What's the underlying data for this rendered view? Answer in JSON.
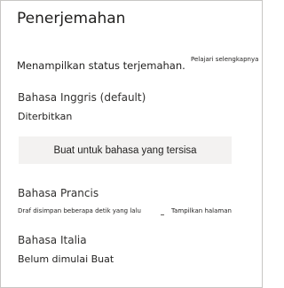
{
  "panel": {
    "title": "Penerjemahan",
    "description": "Menampilkan status terjemahan.",
    "learn_more": "Pelajari selengkapnya"
  },
  "languages": [
    {
      "name": "Bahasa Inggris (default)",
      "status": "Diterbitkan"
    },
    {
      "name": "Bahasa Prancis",
      "status": "Draf disimpan beberapa detik yang lalu",
      "action": "Tampilkan halaman"
    },
    {
      "name": "Bahasa Italia",
      "status": "Belum dimulai Buat"
    }
  ],
  "create_remaining_button": "Buat untuk bahasa yang tersisa"
}
